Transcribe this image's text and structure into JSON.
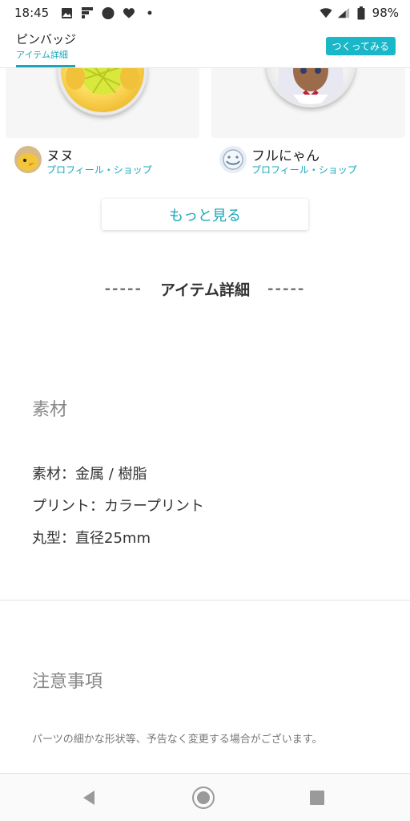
{
  "status": {
    "time": "18:45",
    "battery": "98%",
    "left_icons": [
      "image-icon",
      "flipboard-icon",
      "circle-icon",
      "heart-icon",
      "dot-icon"
    ],
    "right_icons": [
      "wifi-icon",
      "signal-icon",
      "battery-icon"
    ]
  },
  "header": {
    "title": "ピンバッジ",
    "subtitle": "アイテム詳細",
    "make_label": "つくってみる",
    "accent": "#1aa7bb"
  },
  "sellers": [
    {
      "name": "ヌヌ",
      "link": "プロフィール・ショップ"
    },
    {
      "name": "フルにゃん",
      "link": "プロフィール・ショップ"
    }
  ],
  "more_label": "もっと見る",
  "section": {
    "dashes_left": "-----",
    "title": "アイテム詳細",
    "dashes_right": "-----"
  },
  "material": {
    "heading": "素材",
    "specs": [
      "素材：金属 / 樹脂",
      "プリント：カラープリント",
      "丸型：直径25mm"
    ]
  },
  "notice": {
    "heading": "注意事項",
    "text": "パーツの細かな形状等、予告なく変更する場合がございます。"
  },
  "nav": {
    "icons": [
      "back-icon",
      "home-icon",
      "recents-icon"
    ]
  }
}
